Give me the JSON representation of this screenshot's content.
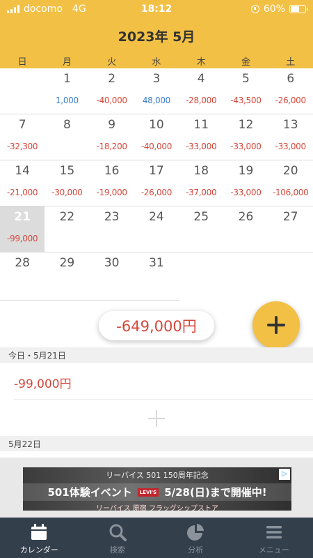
{
  "status": {
    "carrier": "docomo",
    "network": "4G",
    "time": "18:12",
    "battery": "60%"
  },
  "calendar": {
    "title": "2023年 5月",
    "weekdays": [
      "日",
      "月",
      "火",
      "水",
      "木",
      "金",
      "土"
    ],
    "weeks": [
      [
        {
          "day": "",
          "amount": ""
        },
        {
          "day": "1",
          "amount": "1,000",
          "sign": "pos"
        },
        {
          "day": "2",
          "amount": "-40,000",
          "sign": "neg"
        },
        {
          "day": "3",
          "amount": "48,000",
          "sign": "pos"
        },
        {
          "day": "4",
          "amount": "-28,000",
          "sign": "neg"
        },
        {
          "day": "5",
          "amount": "-43,500",
          "sign": "neg"
        },
        {
          "day": "6",
          "amount": "-26,000",
          "sign": "neg"
        }
      ],
      [
        {
          "day": "7",
          "amount": "-32,300",
          "sign": "neg"
        },
        {
          "day": "8",
          "amount": ""
        },
        {
          "day": "9",
          "amount": "-18,200",
          "sign": "neg"
        },
        {
          "day": "10",
          "amount": "-40,000",
          "sign": "neg"
        },
        {
          "day": "11",
          "amount": "-33,000",
          "sign": "neg"
        },
        {
          "day": "12",
          "amount": "-33,000",
          "sign": "neg"
        },
        {
          "day": "13",
          "amount": "-33,000",
          "sign": "neg"
        }
      ],
      [
        {
          "day": "14",
          "amount": "-21,000",
          "sign": "neg"
        },
        {
          "day": "15",
          "amount": "-30,000",
          "sign": "neg"
        },
        {
          "day": "16",
          "amount": "-19,000",
          "sign": "neg"
        },
        {
          "day": "17",
          "amount": "-26,000",
          "sign": "neg"
        },
        {
          "day": "18",
          "amount": "-37,000",
          "sign": "neg"
        },
        {
          "day": "19",
          "amount": "-33,000",
          "sign": "neg"
        },
        {
          "day": "20",
          "amount": "-106,000",
          "sign": "neg"
        }
      ],
      [
        {
          "day": "21",
          "amount": "-99,000",
          "sign": "neg",
          "today": true
        },
        {
          "day": "22",
          "amount": ""
        },
        {
          "day": "23",
          "amount": ""
        },
        {
          "day": "24",
          "amount": ""
        },
        {
          "day": "25",
          "amount": ""
        },
        {
          "day": "26",
          "amount": ""
        },
        {
          "day": "27",
          "amount": ""
        }
      ],
      [
        {
          "day": "28",
          "amount": ""
        },
        {
          "day": "29",
          "amount": ""
        },
        {
          "day": "30",
          "amount": ""
        },
        {
          "day": "31",
          "amount": ""
        },
        {
          "day": "",
          "amount": ""
        },
        {
          "day": "",
          "amount": ""
        },
        {
          "day": "",
          "amount": ""
        }
      ]
    ]
  },
  "total": "-649,000円",
  "today_section": {
    "heading": "今日・5月21日",
    "amount": "-99,000円"
  },
  "next_section": {
    "heading": "5月22日"
  },
  "ad": {
    "top": "リーバイス 501 150周年記念",
    "main": "501体験イベント",
    "brand": "LEVI'S",
    "date": "5/28(日)まで開催中!",
    "bottom": "リーバイス 原宿 フラッグシップストア"
  },
  "tabs": [
    {
      "label": "カレンダー",
      "icon": "calendar-icon",
      "active": true
    },
    {
      "label": "検索",
      "icon": "search-icon"
    },
    {
      "label": "分析",
      "icon": "pie-chart-icon"
    },
    {
      "label": "メニュー",
      "icon": "menu-icon"
    }
  ],
  "colors": {
    "accent": "#f2c044",
    "negative": "#d4483b",
    "positive": "#3a7ec9",
    "tabbar": "#333f4b"
  }
}
